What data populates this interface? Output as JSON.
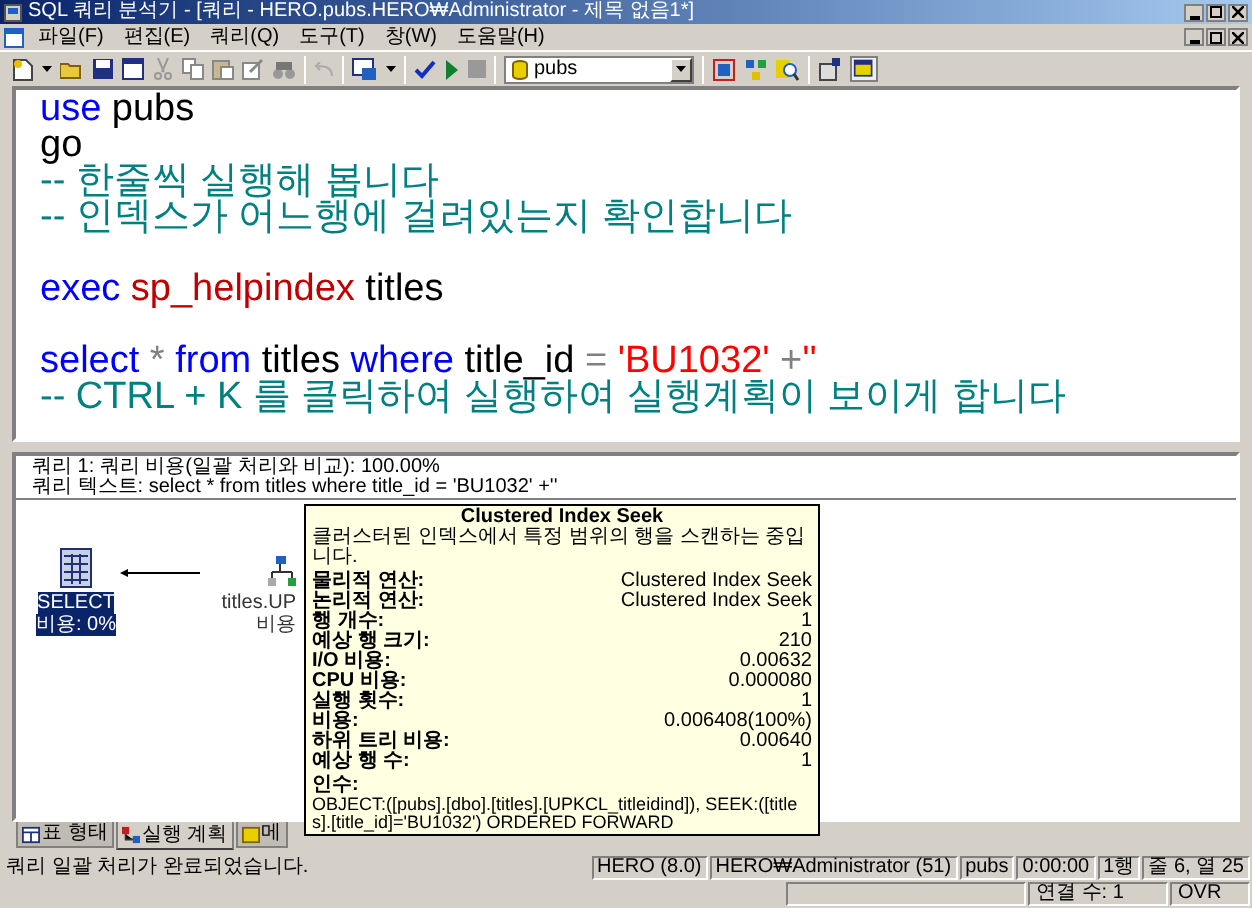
{
  "window": {
    "title": "SQL 쿼리 분석기 - [쿼리 - HERO.pubs.HERO₩Administrator - 제목 없음1*]"
  },
  "menu": [
    "파일(F)",
    "편집(E)",
    "쿼리(Q)",
    "도구(T)",
    "창(W)",
    "도움말(H)"
  ],
  "toolbar": {
    "database": "pubs"
  },
  "editor": {
    "lines": [
      {
        "gap_before": false,
        "segments": [
          {
            "kind": "keyword",
            "text": "use"
          },
          {
            "kind": "plain",
            "text": " pubs"
          }
        ]
      },
      {
        "gap_before": false,
        "segments": [
          {
            "kind": "plain",
            "text": "go"
          }
        ]
      },
      {
        "gap_before": false,
        "segments": [
          {
            "kind": "comment",
            "text": "-- 한줄씩 실행해 봅니다"
          }
        ]
      },
      {
        "gap_before": false,
        "segments": [
          {
            "kind": "comment",
            "text": "-- 인덱스가 어느행에 걸려있는지 확인합니다"
          }
        ]
      },
      {
        "gap_before": true,
        "segments": [
          {
            "kind": "keyword",
            "text": "exec "
          },
          {
            "kind": "procedure",
            "text": "sp_helpindex"
          },
          {
            "kind": "plain",
            "text": " titles"
          }
        ]
      },
      {
        "gap_before": true,
        "segments": [
          {
            "kind": "keyword",
            "text": "select "
          },
          {
            "kind": "operator",
            "text": "* "
          },
          {
            "kind": "keyword",
            "text": "from"
          },
          {
            "kind": "plain",
            "text": " titles "
          },
          {
            "kind": "keyword",
            "text": "where"
          },
          {
            "kind": "plain",
            "text": " title_id "
          },
          {
            "kind": "operator",
            "text": "= "
          },
          {
            "kind": "string",
            "text": "'BU1032' "
          },
          {
            "kind": "operator",
            "text": "+"
          },
          {
            "kind": "string",
            "text": "''"
          }
        ]
      },
      {
        "gap_before": false,
        "segments": [
          {
            "kind": "comment",
            "text": "-- CTRL + K 를 클릭하여 실행하여 실행계획이 보이게 합니다"
          }
        ]
      }
    ]
  },
  "plan": {
    "header": [
      "쿼리 1: 쿼리 비용(일괄 처리와 비교): 100.00%",
      "쿼리 텍스트: select * from titles where title_id = 'BU1032' +''"
    ],
    "nodes": [
      {
        "kind": "select",
        "lines": [
          "SELECT",
          "비용: 0%"
        ],
        "selected": true
      },
      {
        "kind": "seek",
        "lines": [
          "titles.UP",
          "비용"
        ],
        "selected": false
      }
    ]
  },
  "tooltip": {
    "title": "Clustered Index Seek",
    "description": "클러스터된 인덱스에서 특정 범위의 행을 스캔하는 중입니다.",
    "rows": [
      {
        "label": "물리적 연산:",
        "value": "Clustered Index Seek"
      },
      {
        "label": "논리적 연산:",
        "value": "Clustered Index Seek"
      },
      {
        "label": "행 개수:",
        "value": "1"
      },
      {
        "label": "예상 행 크기:",
        "value": "210"
      },
      {
        "label": "I/O 비용:",
        "value": "0.00632"
      },
      {
        "label": "CPU 비용:",
        "value": "0.000080"
      },
      {
        "label": "실행 횟수:",
        "value": "1"
      },
      {
        "label": "비용:",
        "value": "0.006408(100%)"
      },
      {
        "label": "하위 트리 비용:",
        "value": "0.00640"
      },
      {
        "label": "예상 행 수:",
        "value": "1"
      }
    ],
    "argument_label": "인수:",
    "argument": "OBJECT:([pubs].[dbo].[titles].[UPKCL_titleidind]), SEEK:([titles].[title_id]='BU1032') ORDERED FORWARD"
  },
  "tabs": [
    {
      "label": "표 형태",
      "selected": false
    },
    {
      "label": "실행 계획",
      "selected": true
    },
    {
      "label": "메",
      "selected": false
    }
  ],
  "status_bar": {
    "message": "쿼리 일괄 처리가 완료되었습니다.",
    "panels": [
      "HERO (8.0)",
      "HERO₩Administrator (51)",
      "pubs",
      "0:00:00",
      "1행",
      "줄 6, 열 25"
    ]
  },
  "bottom_bar": {
    "panels": [
      "연결 수: 1",
      "OVR"
    ]
  }
}
